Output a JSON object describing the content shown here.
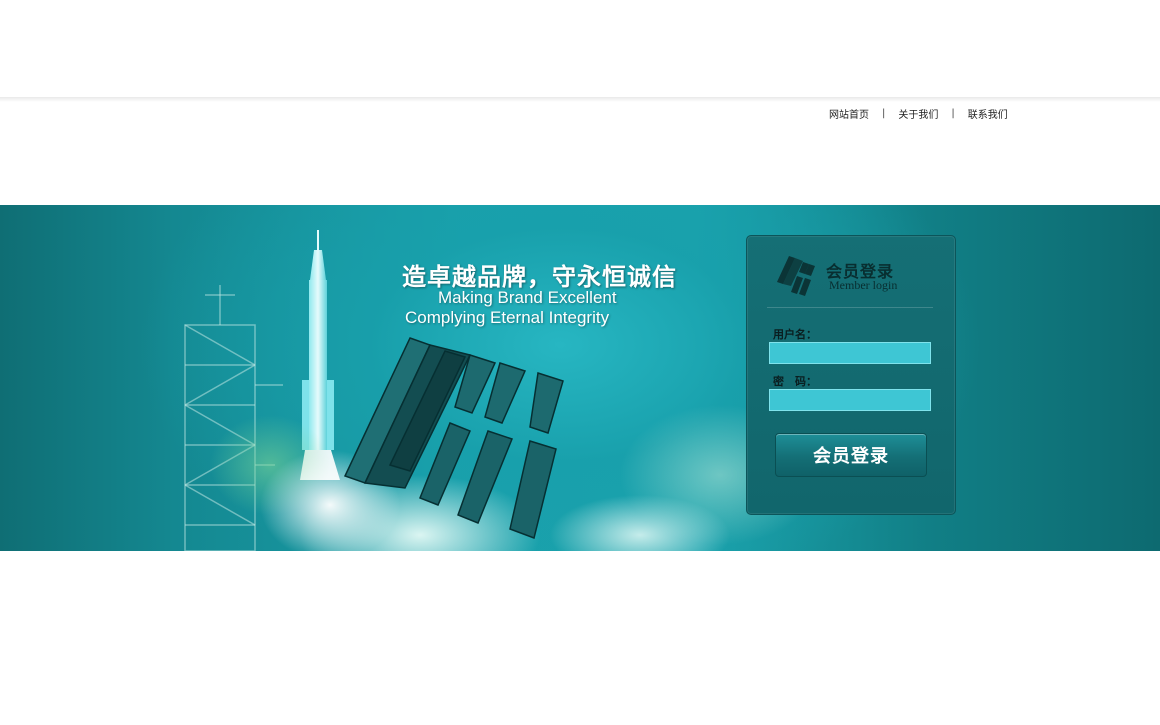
{
  "nav": {
    "items": [
      {
        "label": "网站首页"
      },
      {
        "label": "关于我们"
      },
      {
        "label": "联系我们"
      }
    ],
    "separator": "|"
  },
  "banner": {
    "slogan_cn": "造卓越品牌，守永恒诚信",
    "slogan_en_line1": "Making Brand Excellent",
    "slogan_en_line2": "Complying Eternal Integrity"
  },
  "login": {
    "title": "会员登录",
    "subtitle": "Member login",
    "username_label": "用户名：",
    "username_value": "",
    "password_label": "密　码：",
    "password_value": "",
    "submit_label": "会员登录"
  },
  "colors": {
    "banner_teal": "#1aa0aa",
    "panel_teal": "#156f75",
    "input_fill": "#3ec6d4"
  }
}
